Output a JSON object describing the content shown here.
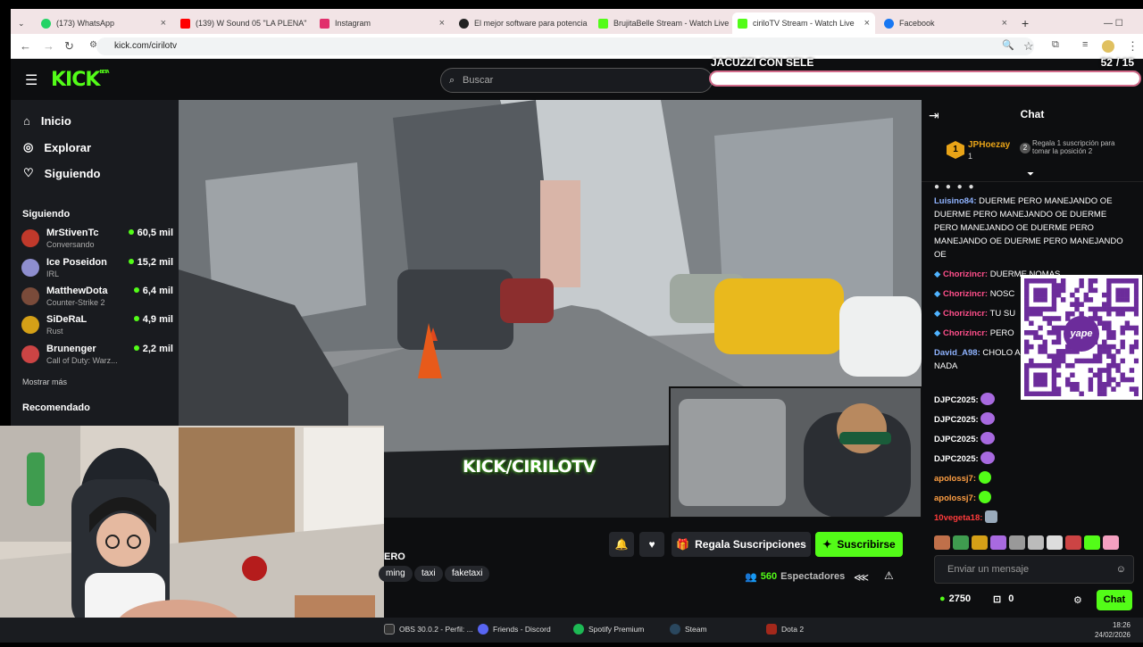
{
  "browser": {
    "tabs": [
      {
        "label": "(173) WhatsApp",
        "color": "#25d366"
      },
      {
        "label": "(139) W Sound 05 \"LA PLENA\"",
        "color": "#ff0000"
      },
      {
        "label": "Instagram",
        "color": "#e1306c"
      },
      {
        "label": "El mejor software para potencia",
        "color": "#222222"
      },
      {
        "label": "BrujitaBelle Stream - Watch Live",
        "color": "#53fc18"
      },
      {
        "label": "ciriloTV Stream - Watch Live",
        "color": "#53fc18"
      },
      {
        "label": "Facebook",
        "color": "#1877f2"
      }
    ],
    "url": "kick.com/cirilotv"
  },
  "header": {
    "logo": "KICK",
    "logo_badge": "BETA",
    "search_placeholder": "Buscar"
  },
  "goal": {
    "title": "JACUZZI CON SELE",
    "current": "52",
    "total": "/ 15",
    "progress": 1.0
  },
  "sidebar": {
    "nav": [
      {
        "label": "Inicio",
        "icon": "home-icon"
      },
      {
        "label": "Explorar",
        "icon": "compass-icon"
      },
      {
        "label": "Siguiendo",
        "icon": "heart-icon"
      }
    ],
    "following_title": "Siguiendo",
    "channels": [
      {
        "name": "MrStivenTc",
        "game": "Conversando",
        "viewers": "60,5 mil",
        "color": "#c0392b"
      },
      {
        "name": "Ice Poseidon",
        "game": "IRL",
        "viewers": "15,2 mil",
        "color": "#8e8ecf"
      },
      {
        "name": "MatthewDota",
        "game": "Counter-Strike 2",
        "viewers": "6,4 mil",
        "color": "#7a4b3a"
      },
      {
        "name": "SiDeRaL",
        "game": "Rust",
        "viewers": "4,9 mil",
        "color": "#d4a017"
      },
      {
        "name": "Brunenger",
        "game": "Call of Duty: Warz...",
        "viewers": "2,2 mil",
        "color": "#c44"
      }
    ],
    "show_more": "Mostrar más",
    "recommended_title": "Recomendado"
  },
  "video": {
    "overlay_text": "KICK/CIRILOTV"
  },
  "stream_info": {
    "title_fragment": "ERO",
    "tags": [
      "ming",
      "taxi",
      "faketaxi"
    ],
    "gift_label": "Regala Suscripciones",
    "subscribe_label": "Suscribirse",
    "viewers": "560",
    "viewers_label": "Espectadores"
  },
  "chat": {
    "title": "Chat",
    "pinned_user": "JPHoezay",
    "pinned_count": "1",
    "pinned_text": "Regala 1 suscripción para tomar la posición 2",
    "messages": [
      {
        "user": "Luisino84:",
        "text": " DUERME PERO MANEJANDO OE DUERME PERO MANEJANDO OE DUERME PERO MANEJANDO OE DUERME PERO MANEJANDO OE DUERME PERO MANEJANDO OE",
        "color": "#8fb3ff"
      },
      {
        "user": "Chorizincr:",
        "text": " DUERME NOMAS",
        "color": "#ff4f8b"
      },
      {
        "user": "Chorizincr:",
        "text": " NOSC",
        "color": "#ff4f8b"
      },
      {
        "user": "Chorizincr:",
        "text": " TU SU",
        "color": "#ff4f8b"
      },
      {
        "user": "Chorizincr:",
        "text": " PERO",
        "color": "#ff4f8b"
      },
      {
        "user": "David_A98:",
        "text": " CHOLO A HORARIO DE EMPEZA NADA",
        "color": "#8fb3ff"
      },
      {
        "user": "DJPC2025:",
        "text": "",
        "color": "#ffffff"
      },
      {
        "user": "DJPC2025:",
        "text": "",
        "color": "#ffffff"
      },
      {
        "user": "DJPC2025:",
        "text": "",
        "color": "#ffffff"
      },
      {
        "user": "DJPC2025:",
        "text": "",
        "color": "#ffffff"
      },
      {
        "user": "apolossj7:",
        "text": "",
        "color": "#ff9f43"
      },
      {
        "user": "apolossj7:",
        "text": "",
        "color": "#ff9f43"
      },
      {
        "user": "10vegeta18:",
        "text": "",
        "color": "#ff3b3b"
      }
    ],
    "input_placeholder": "Enviar un mensaje",
    "points": "2750",
    "gifts": "0",
    "send_label": "Chat"
  },
  "qr": {
    "brand": "yape"
  },
  "taskbar": {
    "items": [
      {
        "label": "OBS 30.0.2 - Perfil: ...",
        "color": "#333333"
      },
      {
        "label": "Friends - Discord",
        "color": "#5865f2"
      },
      {
        "label": "Spotify Premium",
        "color": "#1db954"
      },
      {
        "label": "Steam",
        "color": "#1b2838"
      },
      {
        "label": "Dota 2",
        "color": "#a3281b"
      }
    ],
    "time": "18:26",
    "date": "24/02/2026"
  }
}
